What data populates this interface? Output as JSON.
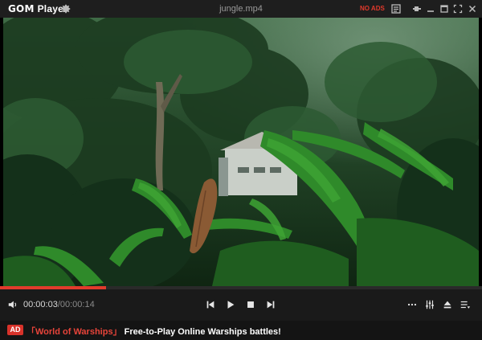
{
  "app": {
    "logo_gom": "GOM",
    "logo_player": "Player",
    "window_title": "jungle.mp4",
    "no_ads_label": "NO ADS"
  },
  "playback": {
    "current_time": "00:00:03",
    "separator": "/",
    "total_time": "00:00:14",
    "progress": 0.22
  },
  "icons": {
    "settings": "gear-icon",
    "playlist": "playlist-icon",
    "pin": "pin-icon",
    "minimize": "minimize-icon",
    "maximize": "maximize-icon",
    "fullscreen": "fullscreen-icon",
    "close": "close-icon",
    "volume": "volume-icon",
    "previous": "previous-icon",
    "play": "play-icon",
    "stop": "stop-icon",
    "next": "next-icon",
    "more": "more-icon",
    "equalizer": "equalizer-icon",
    "eject": "eject-icon",
    "menu": "menu-list-icon"
  },
  "ad": {
    "badge": "AD",
    "bracket_open": "「",
    "game": "World of Warships",
    "bracket_close": "」",
    "text": "Free-to-Play Online Warships battles!"
  },
  "colors": {
    "accent": "#e23b2c",
    "background": "#1a1a1a",
    "titlebar": "#1e1e1e"
  }
}
